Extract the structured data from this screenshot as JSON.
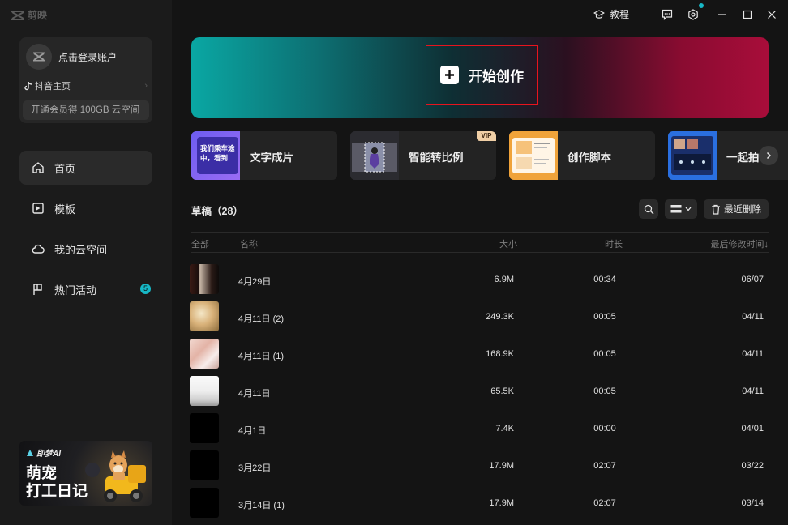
{
  "app": {
    "name": "剪映"
  },
  "sidebar": {
    "login_text": "点击登录账户",
    "douyin_label": "抖音主页",
    "vip_text": "开通会员得 100GB 云空间",
    "nav": [
      {
        "label": "首页",
        "icon": "home-icon",
        "active": true
      },
      {
        "label": "模板",
        "icon": "template-icon"
      },
      {
        "label": "我的云空间",
        "icon": "cloud-icon"
      },
      {
        "label": "热门活动",
        "icon": "flag-icon",
        "badge": "5"
      }
    ],
    "promo": {
      "brand": "即梦AI",
      "title_line1": "萌宠",
      "title_line2": "打工日记"
    }
  },
  "topbar": {
    "tutorial_label": "教程"
  },
  "hero": {
    "label": "开始创作"
  },
  "tools": [
    {
      "label": "文字成片",
      "thumb_text": "我们乘车途中，看到"
    },
    {
      "label": "智能转比例",
      "vip": "VIP"
    },
    {
      "label": "创作脚本"
    },
    {
      "label": "一起拍"
    }
  ],
  "drafts": {
    "title": "草稿（28）",
    "recent_delete_label": "最近删除",
    "columns": {
      "all": "全部",
      "name": "名称",
      "size": "大小",
      "duration": "时长",
      "modified": "最后修改时间↓"
    },
    "rows": [
      {
        "name": "4月29日",
        "size": "6.9M",
        "duration": "00:34",
        "modified": "06/07"
      },
      {
        "name": "4月11日 (2)",
        "size": "249.3K",
        "duration": "00:05",
        "modified": "04/11"
      },
      {
        "name": "4月11日 (1)",
        "size": "168.9K",
        "duration": "00:05",
        "modified": "04/11"
      },
      {
        "name": "4月11日",
        "size": "65.5K",
        "duration": "00:05",
        "modified": "04/11"
      },
      {
        "name": "4月1日",
        "size": "7.4K",
        "duration": "00:00",
        "modified": "04/01"
      },
      {
        "name": "3月22日",
        "size": "17.9M",
        "duration": "02:07",
        "modified": "03/22"
      },
      {
        "name": "3月14日 (1)",
        "size": "17.9M",
        "duration": "02:07",
        "modified": "03/14"
      }
    ]
  },
  "colors": {
    "accent_cyan": "#17b8c6",
    "highlight_red": "#e8141d",
    "background": "#141414",
    "sidebar": "#1b1b1b"
  }
}
